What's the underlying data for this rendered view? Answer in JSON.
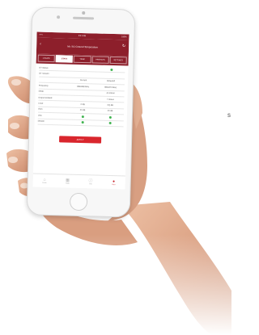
{
  "side_text": "s",
  "phone": {
    "status_bar": {
      "left": "••••• ",
      "time": "9:41 AM",
      "right": "100%"
    },
    "header": {
      "title": "Mr. SG Ground Temperature",
      "back_icon": "back-arrow-icon",
      "right_icon": "refresh-icon"
    },
    "tabs": [
      {
        "label": "LOCATE"
      },
      {
        "label": "STATE"
      },
      {
        "label": "TEMP"
      },
      {
        "label": "PROFILES"
      },
      {
        "label": "SETTINGS"
      }
    ],
    "rows": [
      {
        "label": "DT Status",
        "col2": "",
        "col3": "",
        "status": "ok"
      },
      {
        "label": "DT Version",
        "col2": "",
        "col3": "",
        "status": ""
      },
      {
        "label": "",
        "col2": "Current",
        "col3": "Required",
        "status": ""
      },
      {
        "label": "Frequency",
        "col2": "868-868 MHz",
        "col3": "868-870 MHz",
        "status": ""
      },
      {
        "label": "Mode",
        "col2": "",
        "col3": "ok status",
        "status": ""
      },
      {
        "label": "Output Related",
        "col2": "",
        "col3": "7 status",
        "status": ""
      },
      {
        "label": "Level",
        "col2": "0 dB",
        "col3": "0Q dB",
        "status": ""
      },
      {
        "label": "Gain",
        "col2": "20 dB",
        "col3": "20 dB",
        "status": ""
      },
      {
        "label": "LNA",
        "col2": "",
        "col3": "",
        "status": "ok2"
      },
      {
        "label": "Monitor",
        "col2": "",
        "col3": "",
        "status": "ok2"
      }
    ],
    "action_button": "APPLY",
    "bottom_nav": [
      {
        "label": "Home",
        "icon": "home-icon"
      },
      {
        "label": "Data",
        "icon": "calendar-icon"
      },
      {
        "label": "Info",
        "icon": "info-icon"
      },
      {
        "label": "User",
        "icon": "user-icon"
      }
    ],
    "colors": {
      "accent": "#8d1f2b",
      "button": "#d9262d",
      "ok": "#3fb34f"
    }
  }
}
